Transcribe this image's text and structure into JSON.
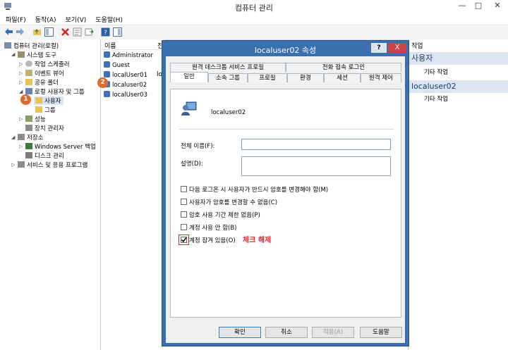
{
  "window": {
    "title": "컴퓨터 관리",
    "minimize": "—",
    "maximize": "□",
    "close": "✕"
  },
  "menu": [
    "파일(F)",
    "동작(A)",
    "보기(V)",
    "도움말(H)"
  ],
  "tree": {
    "items": [
      "컴퓨터 관리(로컬)",
      "시스템 도구",
      "작업 스케줄러",
      "이벤트 뷰어",
      "공유 폴더",
      "로컬 사용자 및 그룹",
      "사용자",
      "그룹",
      "성능",
      "장치 관리자",
      "저장소",
      "Windows Server 백업",
      "디스크 관리",
      "서비스 및 응용 프로그램"
    ]
  },
  "list": {
    "header_name": "이름",
    "header_col2": "전",
    "items": [
      "Administrator",
      "Guest",
      "localUser01",
      "localuser02",
      "localUser03"
    ],
    "extra_col": "lo"
  },
  "badges": {
    "one": "1",
    "two": "2"
  },
  "action": {
    "header_top": "작업",
    "section1": "사용자",
    "section1_item": "기타 작업",
    "section2": "localuser02",
    "section2_item": "기타 작업"
  },
  "dialog": {
    "title": "localuser02 속성",
    "help": "?",
    "close": "X",
    "tabs_row1": [
      "원격 데스크톱 서비스 프로필",
      "전화 접속 로그인"
    ],
    "tabs_row2": [
      "일반",
      "소속 그룹",
      "프로필",
      "환경",
      "세션",
      "원격 제어"
    ],
    "username": "localuser02",
    "fullname_label": "전체 이름(F):",
    "fullname_value": "",
    "desc_label": "설명(D):",
    "desc_value": "",
    "checks": [
      {
        "label": "다음 로그온 시 사용자가 반드시 암호를 변경해야 함(M)",
        "checked": false
      },
      {
        "label": "사용자가 암호를 변경할 수 없음(C)",
        "checked": false
      },
      {
        "label": "암호 사용 기간 제한 없음(P)",
        "checked": false
      },
      {
        "label": "계정 사용 안 함(B)",
        "checked": false
      },
      {
        "label": "계정 잠겨 있음(O)",
        "checked": true
      }
    ],
    "annotation": "체크 해제",
    "buttons": [
      "확인",
      "취소",
      "적용(A)",
      "도움말"
    ]
  },
  "colors": {
    "accent": "#3a6fb0",
    "annotation": "#e8232a",
    "badge": "#e06a2c"
  }
}
